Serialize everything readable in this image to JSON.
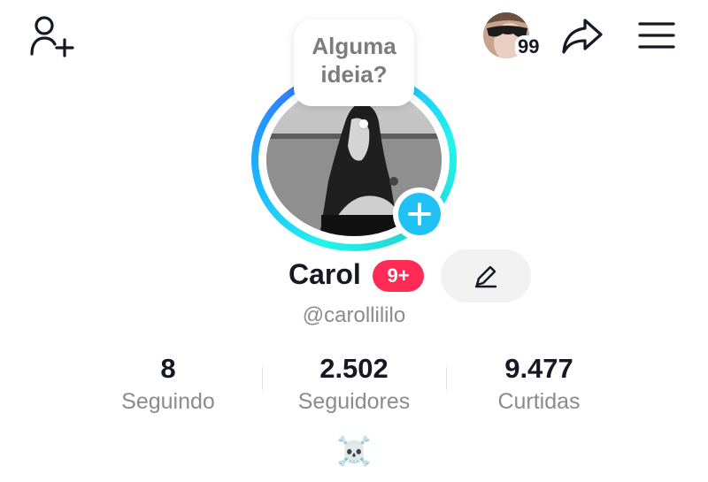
{
  "header": {
    "add_friend_icon": "person-plus-icon",
    "share_icon": "share-arrow-icon",
    "menu_icon": "hamburger-menu-icon",
    "visitors_count": "99"
  },
  "avatar": {
    "prompt_line1": "Alguma",
    "prompt_line2": "ideia?",
    "add_icon": "plus-icon",
    "ring_colors": [
      "#25f4ee",
      "#2f7cff"
    ]
  },
  "profile": {
    "name": "Carol",
    "notification_badge": "9+",
    "handle": "@carollililo",
    "edit_icon": "pencil-icon"
  },
  "stats": [
    {
      "value": "8",
      "label": "Seguindo"
    },
    {
      "value": "2.502",
      "label": "Seguidores"
    },
    {
      "value": "9.477",
      "label": "Curtidas"
    }
  ],
  "bio": {
    "emoji": "☠️"
  },
  "colors": {
    "accent_red": "#fe2c55",
    "accent_blue": "#20c2f5",
    "text_primary": "#161823",
    "text_secondary": "#8a8b91"
  }
}
